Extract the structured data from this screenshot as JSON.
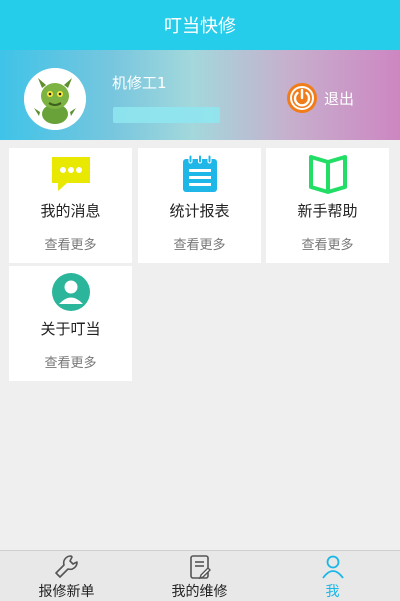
{
  "header": {
    "title": "叮当快修"
  },
  "profile": {
    "username": "机修工1",
    "logout_label": "退出"
  },
  "menu": [
    {
      "label": "我的消息",
      "more": "查看更多",
      "icon": "message-icon",
      "color": "#e8e800"
    },
    {
      "label": "统计报表",
      "more": "查看更多",
      "icon": "report-icon",
      "color": "#1fb6e8"
    },
    {
      "label": "新手帮助",
      "more": "查看更多",
      "icon": "book-icon",
      "color": "#22dd66"
    },
    {
      "label": "关于叮当",
      "more": "查看更多",
      "icon": "user-circle-icon",
      "color": "#2bb59a"
    }
  ],
  "bottom_nav": [
    {
      "label": "报修新单",
      "icon": "wrench-icon",
      "active": false
    },
    {
      "label": "我的维修",
      "icon": "clipboard-edit-icon",
      "active": false
    },
    {
      "label": "我",
      "icon": "person-icon",
      "active": true
    }
  ],
  "colors": {
    "header": "#26cdea",
    "accent": "#1ab7e6",
    "logout": "#f07d1a"
  }
}
